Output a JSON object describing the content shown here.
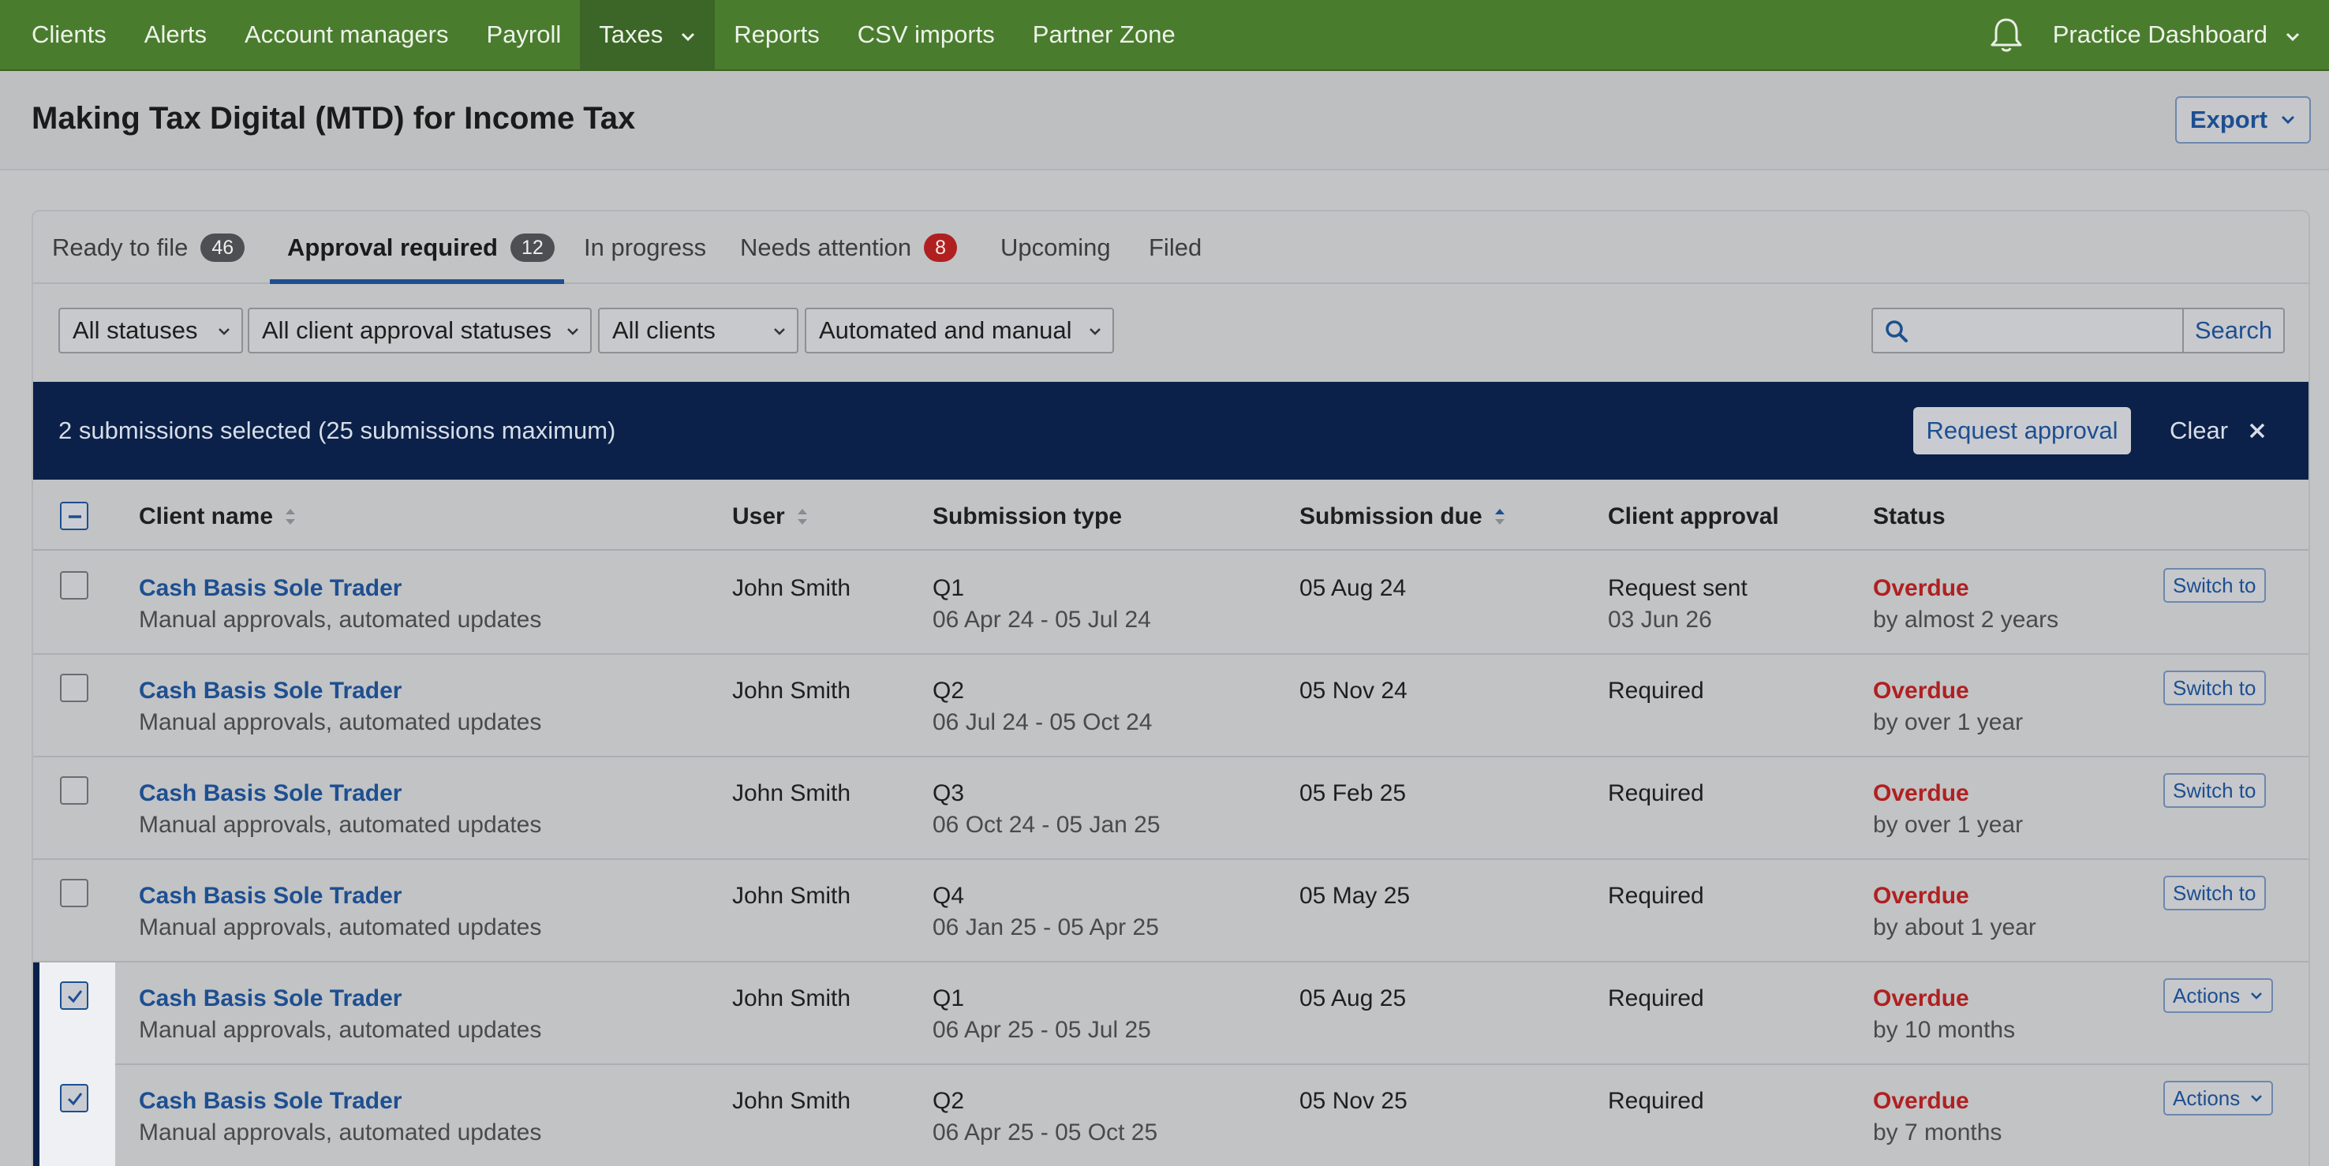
{
  "nav": {
    "items": [
      {
        "label": "Clients",
        "active": false
      },
      {
        "label": "Alerts",
        "active": false
      },
      {
        "label": "Account managers",
        "active": false
      },
      {
        "label": "Payroll",
        "active": false
      },
      {
        "label": "Taxes",
        "active": true,
        "dropdown": true
      },
      {
        "label": "Reports",
        "active": false
      },
      {
        "label": "CSV imports",
        "active": false
      },
      {
        "label": "Partner Zone",
        "active": false
      }
    ],
    "bell_icon": "bell-icon",
    "dashboard_label": "Practice Dashboard"
  },
  "page": {
    "title": "Making Tax Digital (MTD) for Income Tax",
    "export_label": "Export"
  },
  "tabs": [
    {
      "label": "Ready to file",
      "badge": "46",
      "active": false
    },
    {
      "label": "Approval required",
      "badge": "12",
      "active": true
    },
    {
      "label": "In progress",
      "badge": null,
      "active": false
    },
    {
      "label": "Needs attention",
      "badge": "8",
      "active": false
    },
    {
      "label": "Upcoming",
      "badge": null,
      "active": false
    },
    {
      "label": "Filed",
      "badge": null,
      "active": false
    }
  ],
  "filters": {
    "status": "All statuses",
    "client_approval": "All client approval statuses",
    "clients": "All clients",
    "mode": "Automated and manual",
    "search_placeholder": "",
    "search_label": "Search"
  },
  "selection": {
    "text": "2 submissions selected (25 submissions maximum)",
    "request_label": "Request approval",
    "clear_label": "Clear"
  },
  "table": {
    "headers": {
      "client": "Client name",
      "user": "User",
      "type": "Submission type",
      "due": "Submission due",
      "approval": "Client approval",
      "status": "Status"
    },
    "rows": [
      {
        "checked": false,
        "client": "Cash Basis Sole Trader",
        "client_sub": "Manual approvals, automated updates",
        "user": "John Smith",
        "type": "Q1",
        "period": "06 Apr 24 - 05 Jul 24",
        "due": "05 Aug 24",
        "approval": "Request sent",
        "approval_sub": "03 Jun 26",
        "status": "Overdue",
        "status_sub": "by almost 2 years",
        "action": "Switch to",
        "action_dropdown": false
      },
      {
        "checked": false,
        "client": "Cash Basis Sole Trader",
        "client_sub": "Manual approvals, automated updates",
        "user": "John Smith",
        "type": "Q2",
        "period": "06 Jul 24 - 05 Oct 24",
        "due": "05 Nov 24",
        "approval": "Required",
        "approval_sub": "",
        "status": "Overdue",
        "status_sub": "by over 1 year",
        "action": "Switch to",
        "action_dropdown": false
      },
      {
        "checked": false,
        "client": "Cash Basis Sole Trader",
        "client_sub": "Manual approvals, automated updates",
        "user": "John Smith",
        "type": "Q3",
        "period": "06 Oct 24 - 05 Jan 25",
        "due": "05 Feb 25",
        "approval": "Required",
        "approval_sub": "",
        "status": "Overdue",
        "status_sub": "by over 1 year",
        "action": "Switch to",
        "action_dropdown": false
      },
      {
        "checked": false,
        "client": "Cash Basis Sole Trader",
        "client_sub": "Manual approvals, automated updates",
        "user": "John Smith",
        "type": "Q4",
        "period": "06 Jan 25 - 05 Apr 25",
        "due": "05 May 25",
        "approval": "Required",
        "approval_sub": "",
        "status": "Overdue",
        "status_sub": "by about 1 year",
        "action": "Switch to",
        "action_dropdown": false
      },
      {
        "checked": true,
        "client": "Cash Basis Sole Trader",
        "client_sub": "Manual approvals, automated updates",
        "user": "John Smith",
        "type": "Q1",
        "period": "06 Apr 25 - 05 Jul 25",
        "due": "05 Aug 25",
        "approval": "Required",
        "approval_sub": "",
        "status": "Overdue",
        "status_sub": "by 10 months",
        "action": "Actions",
        "action_dropdown": true
      },
      {
        "checked": true,
        "client": "Cash Basis Sole Trader",
        "client_sub": "Manual approvals, automated updates",
        "user": "John Smith",
        "type": "Q2",
        "period": "06 Apr 25 - 05 Oct 25",
        "due": "05 Nov 25",
        "approval": "Required",
        "approval_sub": "",
        "status": "Overdue",
        "status_sub": "by 7 months",
        "action": "Actions",
        "action_dropdown": true
      }
    ]
  },
  "colors": {
    "nav_bg": "#4a7c2e",
    "selection_bar": "#0b2149",
    "link": "#1d4f91",
    "overdue": "#b02020"
  }
}
